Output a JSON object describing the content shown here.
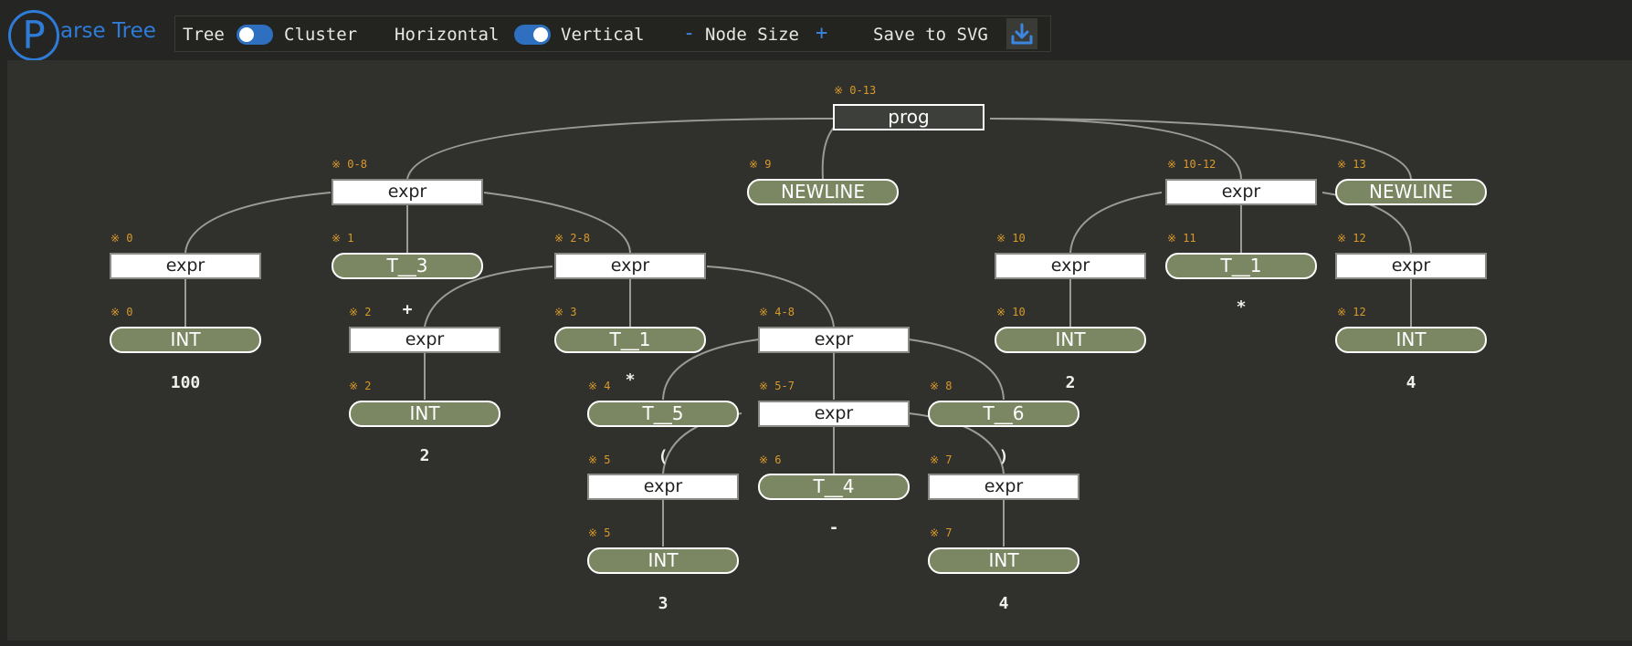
{
  "header": {
    "logo_letter": "P",
    "logo_text": "arse Tree",
    "toolbar": {
      "tree_label": "Tree",
      "cluster_label": "Cluster",
      "horizontal_label": "Horizontal",
      "vertical_label": "Vertical",
      "minus_label": "-",
      "node_size_label": "Node Size",
      "plus_label": "+",
      "save_label": "Save to SVG"
    }
  },
  "colors": {
    "accent": "#2f7bd8",
    "token_fill": "#7b8763",
    "range_text": "#d99a2b",
    "background": "#30302c"
  },
  "tree": {
    "n_prog": {
      "label": "prog",
      "range": "※ 0-13"
    },
    "n_expr08": {
      "label": "expr",
      "range": "※ 0-8"
    },
    "n_nl9": {
      "label": "NEWLINE",
      "range": "※ 9"
    },
    "n_expr1012": {
      "label": "expr",
      "range": "※ 10-12"
    },
    "n_nl13": {
      "label": "NEWLINE",
      "range": "※ 13"
    },
    "n_expr0": {
      "label": "expr",
      "range": "※ 0"
    },
    "n_t3": {
      "label": "T__3",
      "range": "※ 1"
    },
    "n_expr28": {
      "label": "expr",
      "range": "※ 2-8"
    },
    "n_int0": {
      "label": "INT",
      "range": "※ 0"
    },
    "n_expr2": {
      "label": "expr",
      "range": "※ 2"
    },
    "n_t1a": {
      "label": "T__1",
      "range": "※ 3"
    },
    "n_expr48": {
      "label": "expr",
      "range": "※ 4-8"
    },
    "n_int2": {
      "label": "INT",
      "range": "※ 2"
    },
    "n_t5": {
      "label": "T__5",
      "range": "※ 4"
    },
    "n_expr57": {
      "label": "expr",
      "range": "※ 5-7"
    },
    "n_t6": {
      "label": "T__6",
      "range": "※ 8"
    },
    "n_expr5": {
      "label": "expr",
      "range": "※ 5"
    },
    "n_t4": {
      "label": "T__4",
      "range": "※ 6"
    },
    "n_expr7": {
      "label": "expr",
      "range": "※ 7"
    },
    "n_int5": {
      "label": "INT",
      "range": "※ 5"
    },
    "n_int7": {
      "label": "INT",
      "range": "※ 7"
    },
    "n_expr10": {
      "label": "expr",
      "range": "※ 10"
    },
    "n_t1b": {
      "label": "T__1",
      "range": "※ 11"
    },
    "n_expr12": {
      "label": "expr",
      "range": "※ 12"
    },
    "n_int10": {
      "label": "INT",
      "range": "※ 10"
    },
    "n_int12": {
      "label": "INT",
      "range": "※ 12"
    }
  },
  "token_text": {
    "t100": "100",
    "tplus": "+",
    "t2a": "2",
    "tstar_a": "*",
    "tlparen": "(",
    "trparen": ")",
    "tminus": "-",
    "t3": "3",
    "t4a": "4",
    "t2b": "2",
    "tstar_b": "*",
    "t4b": "4"
  }
}
